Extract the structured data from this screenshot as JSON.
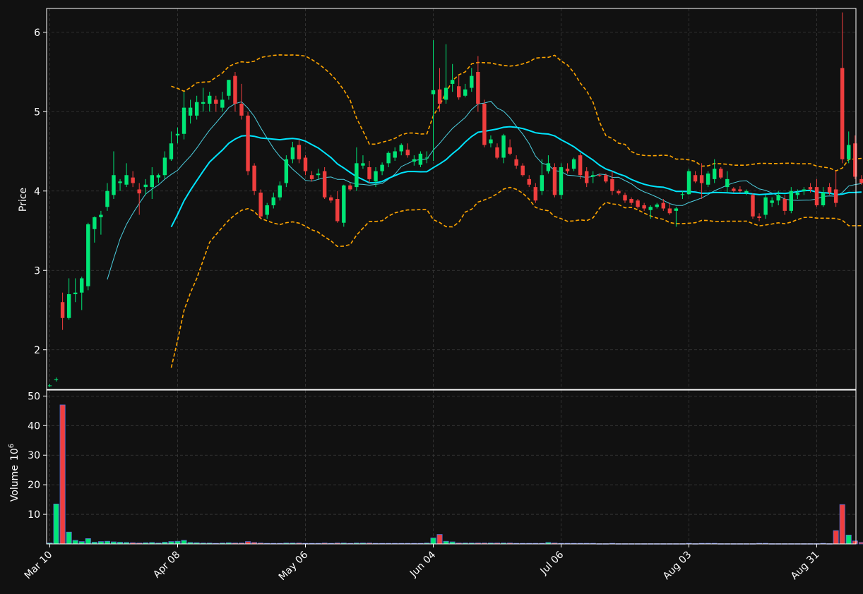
{
  "chart_data": {
    "type": "candlestick",
    "theme": {
      "background": "#111111",
      "up_color": "#00e676",
      "down_color": "#ef3e3e",
      "ma_color": "#00e5ff",
      "ma_fast_color": "#4dd0e1",
      "band_color": "#ffa500",
      "text_color": "#ffffff",
      "grid_color": "#3a3a3a"
    },
    "price_panel": {
      "ylabel": "Price",
      "ylim": [
        1.5,
        6.3
      ],
      "yticks": [
        "2",
        "3",
        "4",
        "5",
        "6"
      ],
      "ytick_values": [
        2,
        3,
        4,
        5,
        6
      ],
      "grid": true
    },
    "volume_panel": {
      "ylabel": "Volume",
      "ylabel_exp": "6",
      "ylim": [
        0,
        52
      ],
      "yticks": [
        "10",
        "20",
        "30",
        "40",
        "50"
      ],
      "ytick_values": [
        10,
        20,
        30,
        40,
        50
      ],
      "grid": true
    },
    "xtick_labels": [
      "Mar 10",
      "Apr 08",
      "May 06",
      "Jun 04",
      "Jul 06",
      "Aug 03",
      "Aug 31"
    ],
    "xtick_index": [
      0,
      20,
      40,
      60,
      80,
      100,
      120
    ],
    "candles": [
      [
        1.55,
        1.57,
        1.53,
        1.55,
        0.3
      ],
      [
        1.62,
        1.65,
        1.6,
        1.63,
        13.5
      ],
      [
        2.6,
        2.72,
        2.25,
        2.4,
        47
      ],
      [
        2.4,
        2.9,
        2.38,
        2.7,
        4
      ],
      [
        2.7,
        2.9,
        2.6,
        2.72,
        1.2
      ],
      [
        2.72,
        2.92,
        2.5,
        2.9,
        0.8
      ],
      [
        2.8,
        3.6,
        2.75,
        3.58,
        1.8
      ],
      [
        3.52,
        3.68,
        3.35,
        3.67,
        0.6
      ],
      [
        3.67,
        3.75,
        3.45,
        3.7,
        0.8
      ],
      [
        3.8,
        4.1,
        3.75,
        4.0,
        0.9
      ],
      [
        3.95,
        4.5,
        3.9,
        4.2,
        0.7
      ],
      [
        4.1,
        4.15,
        4.0,
        4.12,
        0.6
      ],
      [
        4.08,
        4.35,
        4.05,
        4.2,
        0.5
      ],
      [
        4.17,
        4.25,
        4.05,
        4.1,
        0.4
      ],
      [
        4.02,
        4.1,
        3.7,
        3.97,
        0.3
      ],
      [
        4.05,
        4.15,
        3.95,
        4.08,
        0.4
      ],
      [
        4.05,
        4.3,
        3.9,
        4.2,
        0.5
      ],
      [
        4.17,
        4.22,
        4.1,
        4.2,
        0.3
      ],
      [
        4.2,
        4.5,
        4.15,
        4.42,
        0.6
      ],
      [
        4.4,
        4.75,
        4.38,
        4.6,
        0.8
      ],
      [
        4.7,
        4.8,
        4.6,
        4.72,
        0.9
      ],
      [
        4.72,
        5.25,
        4.65,
        5.05,
        1.2
      ],
      [
        4.95,
        5.15,
        4.85,
        5.05,
        0.5
      ],
      [
        4.95,
        5.2,
        4.9,
        5.12,
        0.4
      ],
      [
        5.1,
        5.3,
        5.0,
        5.12,
        0.3
      ],
      [
        5.1,
        5.25,
        5.0,
        5.2,
        0.3
      ],
      [
        5.15,
        5.2,
        5.0,
        5.1,
        0.2
      ],
      [
        5.05,
        5.25,
        5.0,
        5.15,
        0.3
      ],
      [
        5.2,
        5.4,
        5.15,
        5.4,
        0.4
      ],
      [
        5.45,
        5.5,
        5.0,
        5.1,
        0.3
      ],
      [
        5.1,
        5.35,
        4.9,
        4.95,
        0.3
      ],
      [
        4.95,
        5.0,
        4.2,
        4.25,
        0.8
      ],
      [
        4.32,
        4.35,
        3.95,
        4.0,
        0.5
      ],
      [
        3.98,
        4.02,
        3.65,
        3.68,
        0.3
      ],
      [
        3.7,
        3.85,
        3.65,
        3.82,
        0.2
      ],
      [
        3.82,
        3.98,
        3.78,
        3.92,
        0.2
      ],
      [
        3.92,
        4.12,
        3.88,
        4.07,
        0.2
      ],
      [
        4.1,
        4.45,
        4.05,
        4.4,
        0.3
      ],
      [
        4.4,
        4.62,
        4.35,
        4.55,
        0.3
      ],
      [
        4.58,
        4.65,
        4.35,
        4.4,
        0.3
      ],
      [
        4.42,
        4.45,
        4.2,
        4.25,
        0.2
      ],
      [
        4.2,
        4.25,
        4.12,
        4.15,
        0.2
      ],
      [
        4.2,
        4.28,
        4.15,
        4.22,
        0.2
      ],
      [
        4.25,
        4.3,
        3.9,
        3.92,
        0.3
      ],
      [
        3.92,
        3.95,
        3.85,
        3.88,
        0.2
      ],
      [
        3.9,
        4.0,
        3.6,
        3.62,
        0.3
      ],
      [
        3.6,
        4.08,
        3.55,
        4.07,
        0.3
      ],
      [
        4.07,
        4.1,
        4.0,
        4.02,
        0.2
      ],
      [
        4.05,
        4.55,
        4.0,
        4.35,
        0.3
      ],
      [
        4.32,
        4.45,
        4.28,
        4.35,
        0.3
      ],
      [
        4.3,
        4.38,
        4.1,
        4.15,
        0.3
      ],
      [
        4.12,
        4.3,
        4.05,
        4.25,
        0.2
      ],
      [
        4.25,
        4.36,
        4.2,
        4.33,
        0.2
      ],
      [
        4.35,
        4.5,
        4.3,
        4.48,
        0.2
      ],
      [
        4.42,
        4.55,
        4.38,
        4.5,
        0.2
      ],
      [
        4.5,
        4.6,
        4.45,
        4.58,
        0.2
      ],
      [
        4.52,
        4.6,
        4.42,
        4.45,
        0.2
      ],
      [
        4.37,
        4.45,
        4.32,
        4.4,
        0.2
      ],
      [
        4.33,
        4.5,
        4.3,
        4.47,
        0.2
      ],
      [
        4.42,
        4.5,
        4.35,
        4.42,
        0.3
      ],
      [
        5.22,
        5.9,
        4.38,
        5.27,
        2.0
      ],
      [
        5.28,
        5.55,
        5.0,
        5.1,
        3.2
      ],
      [
        5.15,
        5.85,
        5.1,
        5.3,
        0.9
      ],
      [
        5.35,
        5.6,
        5.25,
        5.4,
        0.7
      ],
      [
        5.32,
        5.45,
        5.15,
        5.18,
        0.3
      ],
      [
        5.2,
        5.35,
        5.18,
        5.28,
        0.3
      ],
      [
        5.3,
        5.55,
        5.25,
        5.45,
        0.3
      ],
      [
        5.5,
        5.7,
        5.0,
        5.1,
        0.3
      ],
      [
        5.1,
        5.15,
        4.55,
        4.58,
        0.3
      ],
      [
        4.6,
        4.7,
        4.55,
        4.65,
        0.3
      ],
      [
        4.55,
        4.6,
        4.4,
        4.42,
        0.3
      ],
      [
        4.42,
        4.72,
        4.35,
        4.7,
        0.3
      ],
      [
        4.55,
        4.65,
        4.45,
        4.47,
        0.3
      ],
      [
        4.4,
        4.45,
        4.28,
        4.32,
        0.2
      ],
      [
        4.32,
        4.35,
        4.18,
        4.2,
        0.2
      ],
      [
        4.15,
        4.2,
        4.05,
        4.08,
        0.2
      ],
      [
        4.05,
        4.1,
        3.85,
        3.88,
        0.2
      ],
      [
        4.0,
        4.4,
        3.95,
        4.2,
        0.2
      ],
      [
        4.25,
        4.45,
        4.22,
        4.35,
        0.5
      ],
      [
        4.3,
        4.35,
        3.92,
        3.95,
        0.3
      ],
      [
        3.95,
        4.35,
        3.9,
        4.3,
        0.2
      ],
      [
        4.28,
        4.35,
        4.22,
        4.25,
        0.2
      ],
      [
        4.28,
        4.42,
        4.25,
        4.4,
        0.2
      ],
      [
        4.45,
        4.48,
        4.15,
        4.2,
        0.2
      ],
      [
        4.25,
        4.3,
        4.05,
        4.1,
        0.2
      ],
      [
        4.18,
        4.25,
        4.1,
        4.2,
        0.2
      ],
      [
        4.2,
        4.22,
        4.18,
        4.19,
        0.1
      ],
      [
        4.2,
        4.22,
        4.1,
        4.12,
        0.1
      ],
      [
        4.15,
        4.25,
        3.95,
        4.0,
        0.2
      ],
      [
        4.0,
        4.02,
        3.95,
        3.97,
        0.1
      ],
      [
        3.95,
        3.98,
        3.85,
        3.88,
        0.1
      ],
      [
        3.9,
        3.92,
        3.82,
        3.85,
        0.1
      ],
      [
        3.88,
        3.9,
        3.78,
        3.8,
        0.1
      ],
      [
        3.82,
        3.85,
        3.75,
        3.78,
        0.1
      ],
      [
        3.76,
        3.82,
        3.65,
        3.8,
        0.1
      ],
      [
        3.8,
        3.85,
        3.78,
        3.83,
        0.1
      ],
      [
        3.85,
        3.9,
        3.75,
        3.78,
        0.1
      ],
      [
        3.78,
        3.85,
        3.7,
        3.72,
        0.1
      ],
      [
        3.75,
        3.8,
        3.55,
        3.78,
        0.1
      ],
      [
        3.95,
        4.0,
        3.9,
        3.96,
        0.1
      ],
      [
        3.96,
        4.28,
        3.95,
        4.25,
        0.2
      ],
      [
        4.2,
        4.25,
        4.1,
        4.12,
        0.1
      ],
      [
        4.2,
        4.35,
        3.9,
        4.1,
        0.2
      ],
      [
        4.08,
        4.25,
        4.05,
        4.22,
        0.2
      ],
      [
        4.15,
        4.4,
        4.1,
        4.28,
        0.2
      ],
      [
        4.28,
        4.3,
        4.15,
        4.17,
        0.1
      ],
      [
        4.05,
        4.25,
        3.98,
        4.15,
        0.1
      ],
      [
        4.03,
        4.05,
        3.98,
        4.0,
        0.1
      ],
      [
        4.02,
        4.06,
        3.98,
        4.0,
        0.1
      ],
      [
        3.98,
        4.02,
        3.95,
        4.0,
        0.1
      ],
      [
        3.95,
        3.97,
        3.65,
        3.68,
        0.1
      ],
      [
        3.68,
        3.72,
        3.62,
        3.66,
        0.2
      ],
      [
        3.7,
        3.95,
        3.65,
        3.92,
        0.2
      ],
      [
        3.85,
        3.92,
        3.8,
        3.88,
        0.1
      ],
      [
        3.88,
        4.0,
        3.82,
        3.95,
        0.1
      ],
      [
        3.9,
        3.95,
        3.7,
        3.75,
        0.1
      ],
      [
        3.75,
        4.05,
        3.72,
        4.0,
        0.1
      ],
      [
        3.95,
        4.02,
        3.9,
        3.98,
        0.1
      ],
      [
        4.0,
        4.05,
        3.95,
        4.02,
        0.1
      ],
      [
        4.05,
        4.1,
        3.98,
        4.02,
        0.1
      ],
      [
        4.05,
        4.15,
        3.8,
        3.82,
        0.1
      ],
      [
        3.82,
        4.05,
        3.8,
        3.98,
        0.2
      ],
      [
        4.05,
        4.1,
        3.95,
        3.98,
        0.1
      ],
      [
        4.02,
        4.25,
        3.8,
        3.85,
        4.5
      ],
      [
        5.55,
        6.25,
        4.35,
        4.4,
        13.3
      ],
      [
        4.4,
        4.75,
        4.35,
        4.58,
        3.0
      ],
      [
        4.6,
        4.7,
        4.15,
        4.18,
        1.0
      ],
      [
        4.15,
        4.2,
        4.08,
        4.1,
        0.5
      ]
    ]
  }
}
